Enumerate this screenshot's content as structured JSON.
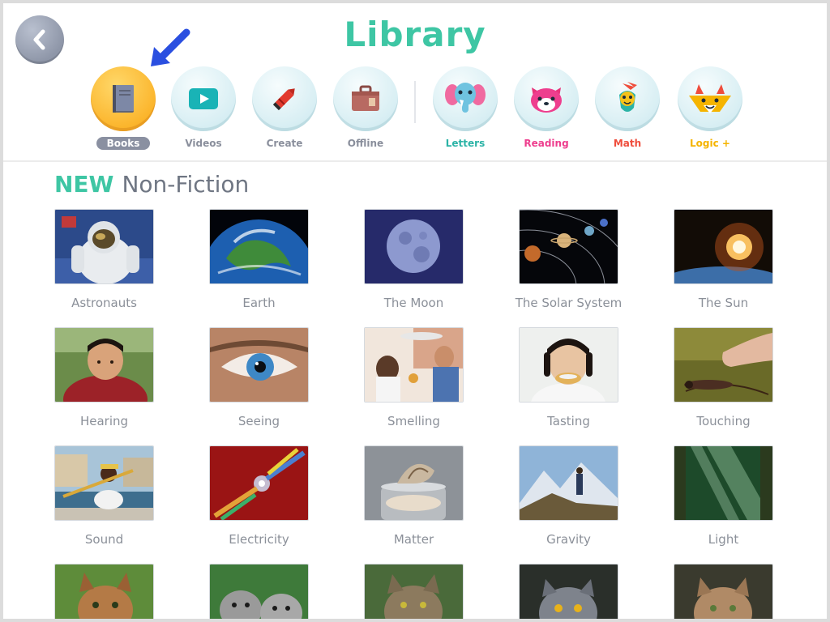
{
  "header": {
    "title": "Library",
    "back_icon": "back-arrow-icon",
    "nav": [
      {
        "label": "Books",
        "icon": "book-icon",
        "active": true,
        "color": "#ffffff"
      },
      {
        "label": "Videos",
        "icon": "video-play-icon",
        "active": false,
        "color": "#8a8f9c"
      },
      {
        "label": "Create",
        "icon": "crayon-icon",
        "active": false,
        "color": "#8a8f9c"
      },
      {
        "label": "Offline",
        "icon": "suitcase-icon",
        "active": false,
        "color": "#8a8f9c"
      },
      {
        "label": "Letters",
        "icon": "elephant-icon",
        "active": false,
        "color": "#2bb3a6"
      },
      {
        "label": "Reading",
        "icon": "red-panda-icon",
        "active": false,
        "color": "#ee3e8e"
      },
      {
        "label": "Math",
        "icon": "bird-icon",
        "active": false,
        "color": "#ef4d3c"
      },
      {
        "label": "Logic +",
        "icon": "fox-icon",
        "active": false,
        "color": "#f5b400"
      }
    ]
  },
  "section": {
    "new_label": "NEW",
    "title": "Non-Fiction"
  },
  "books": [
    {
      "title": "Astronauts"
    },
    {
      "title": "Earth"
    },
    {
      "title": "The Moon"
    },
    {
      "title": "The Solar System"
    },
    {
      "title": "The Sun"
    },
    {
      "title": "Hearing"
    },
    {
      "title": "Seeing"
    },
    {
      "title": "Smelling"
    },
    {
      "title": "Tasting"
    },
    {
      "title": "Touching"
    },
    {
      "title": "Sound"
    },
    {
      "title": "Electricity"
    },
    {
      "title": "Matter"
    },
    {
      "title": "Gravity"
    },
    {
      "title": "Light"
    },
    {
      "title": ""
    },
    {
      "title": ""
    },
    {
      "title": ""
    },
    {
      "title": ""
    },
    {
      "title": ""
    }
  ],
  "colors": {
    "accent": "#3ec6a4",
    "active_nav": "#fbb52c",
    "pointer": "#2a4fe0"
  }
}
